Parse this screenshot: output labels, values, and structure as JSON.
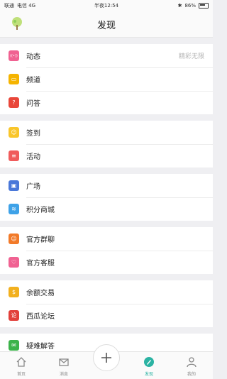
{
  "status": {
    "carrier": "联通",
    "carrier2": "电信 4G",
    "time": "半夜12:54",
    "battery": "86%"
  },
  "header": {
    "title": "发现"
  },
  "groups": [
    [
      {
        "label": "动态",
        "extra": "精彩无限",
        "icon": "broadcast-icon",
        "color": "#f06292"
      },
      {
        "label": "频道",
        "icon": "channel-icon",
        "color": "#f5b400"
      },
      {
        "label": "问答",
        "icon": "qa-icon",
        "color": "#e9473a"
      }
    ],
    [
      {
        "label": "签到",
        "icon": "checkin-icon",
        "color": "#f9c62b"
      },
      {
        "label": "活动",
        "icon": "activity-icon",
        "color": "#f05c5c"
      }
    ],
    [
      {
        "label": "广场",
        "icon": "square-icon",
        "color": "#4a78d9"
      },
      {
        "label": "积分商城",
        "icon": "points-mall-icon",
        "color": "#3ea2e8"
      }
    ],
    [
      {
        "label": "官方群聊",
        "icon": "group-chat-icon",
        "color": "#f27a29"
      },
      {
        "label": "官方客服",
        "icon": "service-icon",
        "color": "#f06292"
      }
    ],
    [
      {
        "label": "余额交易",
        "icon": "balance-icon",
        "color": "#f2b01e"
      },
      {
        "label": "西瓜论坛",
        "icon": "forum-icon",
        "color": "#e2403a"
      }
    ],
    [
      {
        "label": "疑难解答",
        "icon": "wechat-icon",
        "color": "#3cb34a"
      }
    ]
  ],
  "tabs": [
    {
      "label": "首页",
      "icon": "home-icon",
      "active": false
    },
    {
      "label": "消息",
      "icon": "mail-icon",
      "active": false
    },
    {
      "label": "",
      "icon": "plus-icon",
      "active": false
    },
    {
      "label": "发现",
      "icon": "discover-icon",
      "active": true
    },
    {
      "label": "我的",
      "icon": "profile-icon",
      "active": false
    }
  ]
}
